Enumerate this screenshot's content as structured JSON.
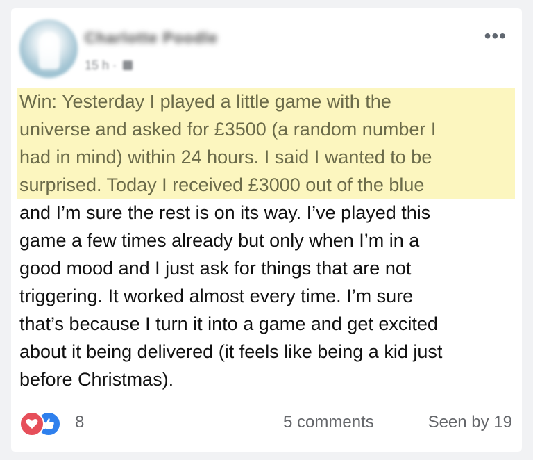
{
  "post": {
    "author_name": "Charlotte Poodle",
    "time": "15 h",
    "menu_icon": "more-icon",
    "highlighted_lines": [
      "Win: Yesterday I played a little game with the",
      "universe and asked for £3500 (a random number I",
      "had in mind) within 24 hours. I said I wanted to be",
      "surprised. Today I received £3000 out of the blue"
    ],
    "body_lines": [
      "and I’m sure the rest is on its way. I’ve played this",
      "game a few times already but only when I’m in a",
      "good mood and I just ask for things that are not",
      "triggering. It worked almost every time. I’m sure",
      "that’s because I turn it into a game and get excited",
      "about it being delivered (it feels like being a kid just",
      "before Christmas)."
    ]
  },
  "footer": {
    "reaction_count": "8",
    "comments": "5 comments",
    "seen_by": "Seen by 19"
  },
  "colors": {
    "highlight": "#fcf6bf",
    "love": "#e64f5a",
    "like": "#2f80ed"
  }
}
